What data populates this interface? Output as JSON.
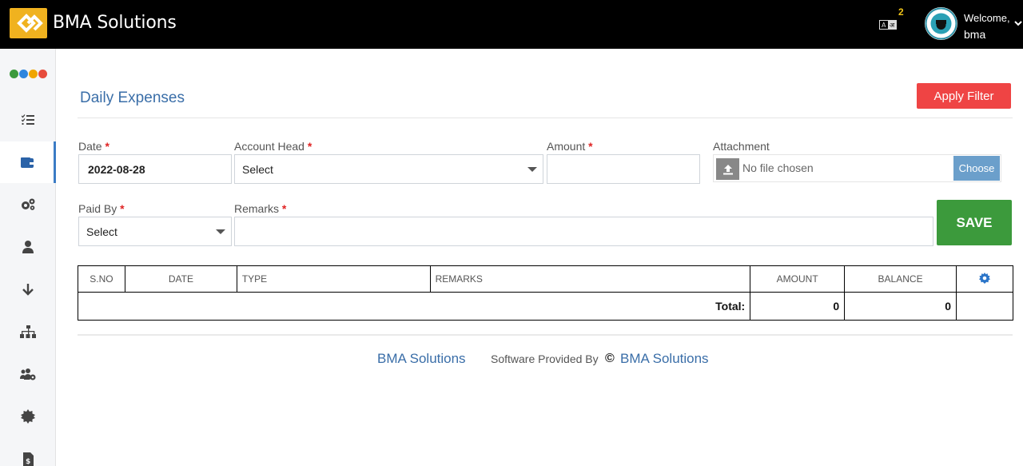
{
  "header": {
    "brand": "BMA Solutions",
    "notification_count": "2",
    "welcome": "Welcome,",
    "username": "bma"
  },
  "sidebar": {
    "dot_colors": [
      "#3c9a3c",
      "#2e86de",
      "#f0a500",
      "#e74c3c"
    ],
    "items": [
      {
        "icon": "list-check-icon",
        "active": false
      },
      {
        "icon": "wallet-icon",
        "active": true
      },
      {
        "icon": "gears-icon",
        "active": false
      },
      {
        "icon": "user-icon",
        "active": false
      },
      {
        "icon": "arrow-down-icon",
        "active": false
      },
      {
        "icon": "sitemap-icon",
        "active": false
      },
      {
        "icon": "users-gear-icon",
        "active": false
      },
      {
        "icon": "badge-icon",
        "active": false
      },
      {
        "icon": "invoice-icon",
        "active": false
      }
    ]
  },
  "page": {
    "title": "Daily Expenses",
    "apply_filter": "Apply Filter"
  },
  "form": {
    "date_label": "Date",
    "date_value": "2022-08-28",
    "account_head_label": "Account Head",
    "account_head_value": "Select",
    "amount_label": "Amount",
    "amount_value": "",
    "attachment_label": "Attachment",
    "no_file": "No file chosen",
    "choose": "Choose",
    "paid_by_label": "Paid By",
    "paid_by_value": "Select",
    "remarks_label": "Remarks",
    "remarks_value": "",
    "required_mark": "*",
    "save": "SAVE"
  },
  "table": {
    "columns": [
      "S.NO",
      "DATE",
      "TYPE",
      "REMARKS",
      "AMOUNT",
      "BALANCE"
    ],
    "total_label": "Total:",
    "total_amount": "0",
    "total_balance": "0"
  },
  "footer": {
    "brand": "BMA Solutions",
    "provided_by": "Software Provided By",
    "copyright": "©",
    "brand2": "BMA Solutions"
  },
  "colors": {
    "accent": "#3a6ea8",
    "danger": "#ef4444",
    "success": "#3c9a3c",
    "logo": "#f0b21f"
  }
}
